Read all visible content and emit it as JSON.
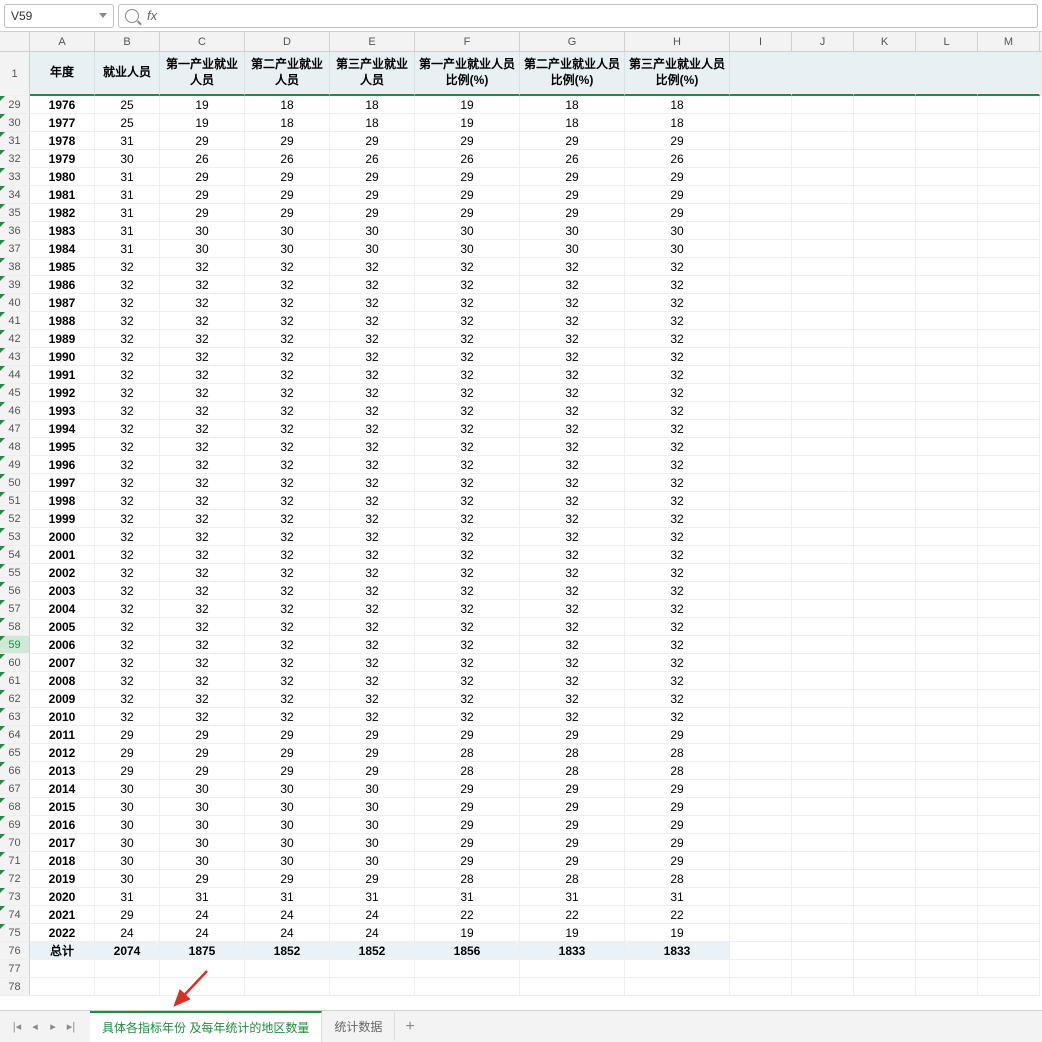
{
  "formula_bar": {
    "cell_ref": "V59",
    "fx_label": "fx"
  },
  "col_letters": [
    "A",
    "B",
    "C",
    "D",
    "E",
    "F",
    "G",
    "H",
    "I",
    "J",
    "K",
    "L",
    "M"
  ],
  "headers": [
    "年度",
    "就业人员",
    "第一产业就业人员",
    "第二产业就业人员",
    "第三产业就业人员",
    "第一产业就业人员比例(%)",
    "第二产业就业人员比例(%)",
    "第三产业就业人员比例(%)"
  ],
  "frozen_row_num": "1",
  "selected_row": 59,
  "rows": [
    {
      "n": 29,
      "d": [
        "1976",
        "25",
        "19",
        "18",
        "18",
        "19",
        "18",
        "18"
      ]
    },
    {
      "n": 30,
      "d": [
        "1977",
        "25",
        "19",
        "18",
        "18",
        "19",
        "18",
        "18"
      ]
    },
    {
      "n": 31,
      "d": [
        "1978",
        "31",
        "29",
        "29",
        "29",
        "29",
        "29",
        "29"
      ]
    },
    {
      "n": 32,
      "d": [
        "1979",
        "30",
        "26",
        "26",
        "26",
        "26",
        "26",
        "26"
      ]
    },
    {
      "n": 33,
      "d": [
        "1980",
        "31",
        "29",
        "29",
        "29",
        "29",
        "29",
        "29"
      ]
    },
    {
      "n": 34,
      "d": [
        "1981",
        "31",
        "29",
        "29",
        "29",
        "29",
        "29",
        "29"
      ]
    },
    {
      "n": 35,
      "d": [
        "1982",
        "31",
        "29",
        "29",
        "29",
        "29",
        "29",
        "29"
      ]
    },
    {
      "n": 36,
      "d": [
        "1983",
        "31",
        "30",
        "30",
        "30",
        "30",
        "30",
        "30"
      ]
    },
    {
      "n": 37,
      "d": [
        "1984",
        "31",
        "30",
        "30",
        "30",
        "30",
        "30",
        "30"
      ]
    },
    {
      "n": 38,
      "d": [
        "1985",
        "32",
        "32",
        "32",
        "32",
        "32",
        "32",
        "32"
      ]
    },
    {
      "n": 39,
      "d": [
        "1986",
        "32",
        "32",
        "32",
        "32",
        "32",
        "32",
        "32"
      ]
    },
    {
      "n": 40,
      "d": [
        "1987",
        "32",
        "32",
        "32",
        "32",
        "32",
        "32",
        "32"
      ]
    },
    {
      "n": 41,
      "d": [
        "1988",
        "32",
        "32",
        "32",
        "32",
        "32",
        "32",
        "32"
      ]
    },
    {
      "n": 42,
      "d": [
        "1989",
        "32",
        "32",
        "32",
        "32",
        "32",
        "32",
        "32"
      ]
    },
    {
      "n": 43,
      "d": [
        "1990",
        "32",
        "32",
        "32",
        "32",
        "32",
        "32",
        "32"
      ]
    },
    {
      "n": 44,
      "d": [
        "1991",
        "32",
        "32",
        "32",
        "32",
        "32",
        "32",
        "32"
      ]
    },
    {
      "n": 45,
      "d": [
        "1992",
        "32",
        "32",
        "32",
        "32",
        "32",
        "32",
        "32"
      ]
    },
    {
      "n": 46,
      "d": [
        "1993",
        "32",
        "32",
        "32",
        "32",
        "32",
        "32",
        "32"
      ]
    },
    {
      "n": 47,
      "d": [
        "1994",
        "32",
        "32",
        "32",
        "32",
        "32",
        "32",
        "32"
      ]
    },
    {
      "n": 48,
      "d": [
        "1995",
        "32",
        "32",
        "32",
        "32",
        "32",
        "32",
        "32"
      ]
    },
    {
      "n": 49,
      "d": [
        "1996",
        "32",
        "32",
        "32",
        "32",
        "32",
        "32",
        "32"
      ]
    },
    {
      "n": 50,
      "d": [
        "1997",
        "32",
        "32",
        "32",
        "32",
        "32",
        "32",
        "32"
      ]
    },
    {
      "n": 51,
      "d": [
        "1998",
        "32",
        "32",
        "32",
        "32",
        "32",
        "32",
        "32"
      ]
    },
    {
      "n": 52,
      "d": [
        "1999",
        "32",
        "32",
        "32",
        "32",
        "32",
        "32",
        "32"
      ]
    },
    {
      "n": 53,
      "d": [
        "2000",
        "32",
        "32",
        "32",
        "32",
        "32",
        "32",
        "32"
      ]
    },
    {
      "n": 54,
      "d": [
        "2001",
        "32",
        "32",
        "32",
        "32",
        "32",
        "32",
        "32"
      ]
    },
    {
      "n": 55,
      "d": [
        "2002",
        "32",
        "32",
        "32",
        "32",
        "32",
        "32",
        "32"
      ]
    },
    {
      "n": 56,
      "d": [
        "2003",
        "32",
        "32",
        "32",
        "32",
        "32",
        "32",
        "32"
      ]
    },
    {
      "n": 57,
      "d": [
        "2004",
        "32",
        "32",
        "32",
        "32",
        "32",
        "32",
        "32"
      ]
    },
    {
      "n": 58,
      "d": [
        "2005",
        "32",
        "32",
        "32",
        "32",
        "32",
        "32",
        "32"
      ]
    },
    {
      "n": 59,
      "d": [
        "2006",
        "32",
        "32",
        "32",
        "32",
        "32",
        "32",
        "32"
      ]
    },
    {
      "n": 60,
      "d": [
        "2007",
        "32",
        "32",
        "32",
        "32",
        "32",
        "32",
        "32"
      ]
    },
    {
      "n": 61,
      "d": [
        "2008",
        "32",
        "32",
        "32",
        "32",
        "32",
        "32",
        "32"
      ]
    },
    {
      "n": 62,
      "d": [
        "2009",
        "32",
        "32",
        "32",
        "32",
        "32",
        "32",
        "32"
      ]
    },
    {
      "n": 63,
      "d": [
        "2010",
        "32",
        "32",
        "32",
        "32",
        "32",
        "32",
        "32"
      ]
    },
    {
      "n": 64,
      "d": [
        "2011",
        "29",
        "29",
        "29",
        "29",
        "29",
        "29",
        "29"
      ]
    },
    {
      "n": 65,
      "d": [
        "2012",
        "29",
        "29",
        "29",
        "29",
        "28",
        "28",
        "28"
      ]
    },
    {
      "n": 66,
      "d": [
        "2013",
        "29",
        "29",
        "29",
        "29",
        "28",
        "28",
        "28"
      ]
    },
    {
      "n": 67,
      "d": [
        "2014",
        "30",
        "30",
        "30",
        "30",
        "29",
        "29",
        "29"
      ]
    },
    {
      "n": 68,
      "d": [
        "2015",
        "30",
        "30",
        "30",
        "30",
        "29",
        "29",
        "29"
      ]
    },
    {
      "n": 69,
      "d": [
        "2016",
        "30",
        "30",
        "30",
        "30",
        "29",
        "29",
        "29"
      ]
    },
    {
      "n": 70,
      "d": [
        "2017",
        "30",
        "30",
        "30",
        "30",
        "29",
        "29",
        "29"
      ]
    },
    {
      "n": 71,
      "d": [
        "2018",
        "30",
        "30",
        "30",
        "30",
        "29",
        "29",
        "29"
      ]
    },
    {
      "n": 72,
      "d": [
        "2019",
        "30",
        "29",
        "29",
        "29",
        "28",
        "28",
        "28"
      ]
    },
    {
      "n": 73,
      "d": [
        "2020",
        "31",
        "31",
        "31",
        "31",
        "31",
        "31",
        "31"
      ]
    },
    {
      "n": 74,
      "d": [
        "2021",
        "29",
        "24",
        "24",
        "24",
        "22",
        "22",
        "22"
      ]
    },
    {
      "n": 75,
      "d": [
        "2022",
        "24",
        "24",
        "24",
        "24",
        "19",
        "19",
        "19"
      ]
    }
  ],
  "total_row": {
    "n": 76,
    "label": "总计",
    "d": [
      "2074",
      "1875",
      "1852",
      "1852",
      "1856",
      "1833",
      "1833"
    ]
  },
  "empty_rows": [
    77,
    78
  ],
  "tabs": {
    "active": "具体各指标年份 及每年统计的地区数量",
    "other": "统计数据"
  }
}
